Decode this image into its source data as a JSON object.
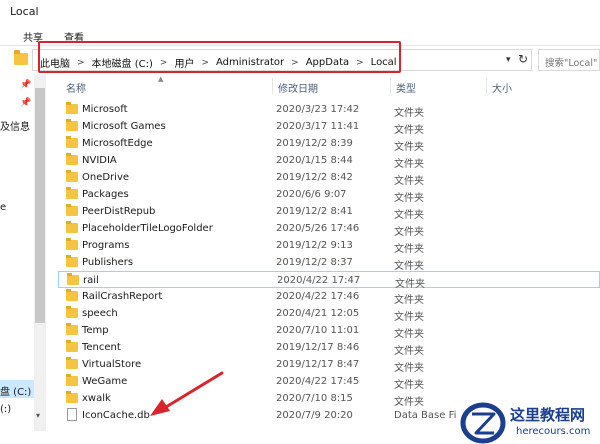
{
  "window": {
    "title": "Local"
  },
  "ribbon": {
    "tabs": [
      "共享",
      "查看"
    ]
  },
  "address": {
    "crumbs": [
      "此电脑",
      "本地磁盘 (C:)",
      "用户",
      "Administrator",
      "AppData",
      "Local"
    ],
    "search_placeholder": "搜索\"Local\""
  },
  "columns": {
    "name": "名称",
    "date": "修改日期",
    "type": "类型",
    "size": "大小"
  },
  "left_pane": {
    "items": [
      "及信息",
      "e",
      "盘 (C:)",
      "(:)"
    ]
  },
  "files": [
    {
      "name": "Microsoft",
      "date": "2020/3/23 17:42",
      "type": "文件夹",
      "icon": "folder-icon"
    },
    {
      "name": "Microsoft Games",
      "date": "2020/3/17 11:41",
      "type": "文件夹",
      "icon": "folder-icon"
    },
    {
      "name": "MicrosoftEdge",
      "date": "2019/12/2 8:39",
      "type": "文件夹",
      "icon": "folder-icon"
    },
    {
      "name": "NVIDIA",
      "date": "2020/1/15 8:44",
      "type": "文件夹",
      "icon": "folder-icon"
    },
    {
      "name": "OneDrive",
      "date": "2019/12/2 8:42",
      "type": "文件夹",
      "icon": "folder-icon"
    },
    {
      "name": "Packages",
      "date": "2020/6/6 9:07",
      "type": "文件夹",
      "icon": "folder-icon"
    },
    {
      "name": "PeerDistRepub",
      "date": "2019/12/2 8:41",
      "type": "文件夹",
      "icon": "folder-icon"
    },
    {
      "name": "PlaceholderTileLogoFolder",
      "date": "2020/5/26 17:46",
      "type": "文件夹",
      "icon": "folder-icon"
    },
    {
      "name": "Programs",
      "date": "2019/12/2 9:13",
      "type": "文件夹",
      "icon": "folder-icon"
    },
    {
      "name": "Publishers",
      "date": "2019/12/2 8:37",
      "type": "文件夹",
      "icon": "folder-icon"
    },
    {
      "name": "rail",
      "date": "2020/4/22 17:47",
      "type": "文件夹",
      "icon": "folder-icon",
      "selected": true
    },
    {
      "name": "RailCrashReport",
      "date": "2020/4/22 17:46",
      "type": "文件夹",
      "icon": "folder-icon"
    },
    {
      "name": "speech",
      "date": "2020/4/21 12:05",
      "type": "文件夹",
      "icon": "folder-icon"
    },
    {
      "name": "Temp",
      "date": "2020/7/10 11:01",
      "type": "文件夹",
      "icon": "folder-icon"
    },
    {
      "name": "Tencent",
      "date": "2019/12/17 8:46",
      "type": "文件夹",
      "icon": "folder-icon"
    },
    {
      "name": "VirtualStore",
      "date": "2019/12/17 8:47",
      "type": "文件夹",
      "icon": "folder-icon"
    },
    {
      "name": "WeGame",
      "date": "2020/4/22 17:45",
      "type": "文件夹",
      "icon": "folder-icon"
    },
    {
      "name": "xwalk",
      "date": "2020/7/10 8:15",
      "type": "文件夹",
      "icon": "folder-icon"
    },
    {
      "name": "IconCache.db",
      "date": "2020/7/9 20:20",
      "type": "Data Base Fi",
      "icon": "db-file-icon"
    }
  ],
  "watermark": {
    "title": "这里教程网",
    "url": "herecours.com"
  },
  "colors": {
    "highlight": "#d9232d",
    "folder": "#f5c542",
    "selection": "#99d1ff"
  }
}
